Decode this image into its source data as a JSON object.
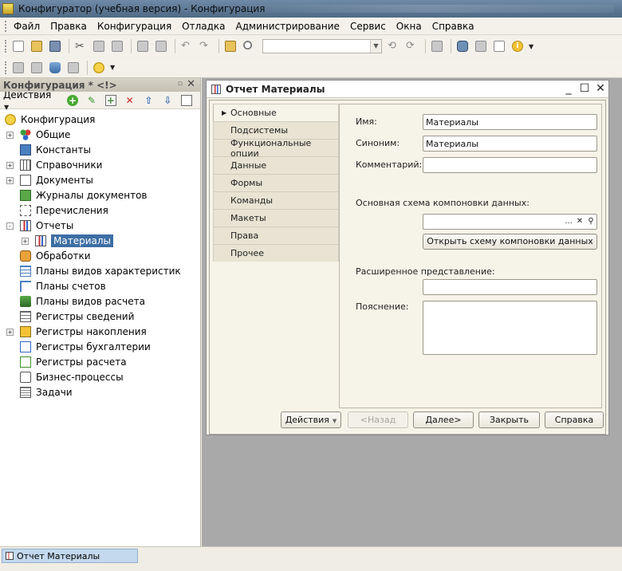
{
  "window_title": "Конфигуратор (учебная версия) - Конфигурация",
  "menu": [
    "Файл",
    "Правка",
    "Конфигурация",
    "Отладка",
    "Администрирование",
    "Сервис",
    "Окна",
    "Справка"
  ],
  "left_panel": {
    "title": "Конфигурация * <!>",
    "actions_label": "Действия",
    "tree": [
      {
        "label": "Конфигурация",
        "level": 0,
        "expander": "",
        "icon": "config-icon"
      },
      {
        "label": "Общие",
        "level": 1,
        "expander": "+",
        "icon": "common-icon"
      },
      {
        "label": "Константы",
        "level": 1,
        "expander": "",
        "icon": "constants-icon"
      },
      {
        "label": "Справочники",
        "level": 1,
        "expander": "+",
        "icon": "catalogs-icon"
      },
      {
        "label": "Документы",
        "level": 1,
        "expander": "+",
        "icon": "documents-icon"
      },
      {
        "label": "Журналы документов",
        "level": 1,
        "expander": "",
        "icon": "journals-icon"
      },
      {
        "label": "Перечисления",
        "level": 1,
        "expander": "",
        "icon": "enums-icon"
      },
      {
        "label": "Отчеты",
        "level": 1,
        "expander": "-",
        "icon": "reports-icon"
      },
      {
        "label": "Материалы",
        "level": 2,
        "expander": "+",
        "icon": "report-item-icon",
        "selected": true
      },
      {
        "label": "Обработки",
        "level": 1,
        "expander": "",
        "icon": "processing-icon"
      },
      {
        "label": "Планы видов характеристик",
        "level": 1,
        "expander": "",
        "icon": "char-plans-icon"
      },
      {
        "label": "Планы счетов",
        "level": 1,
        "expander": "",
        "icon": "accounts-plans-icon"
      },
      {
        "label": "Планы видов расчета",
        "level": 1,
        "expander": "",
        "icon": "calc-plans-icon"
      },
      {
        "label": "Регистры сведений",
        "level": 1,
        "expander": "",
        "icon": "info-registers-icon"
      },
      {
        "label": "Регистры накопления",
        "level": 1,
        "expander": "+",
        "icon": "accum-registers-icon"
      },
      {
        "label": "Регистры бухгалтерии",
        "level": 1,
        "expander": "",
        "icon": "acct-registers-icon"
      },
      {
        "label": "Регистры расчета",
        "level": 1,
        "expander": "",
        "icon": "calc-registers-icon"
      },
      {
        "label": "Бизнес-процессы",
        "level": 1,
        "expander": "",
        "icon": "bizproc-icon"
      },
      {
        "label": "Задачи",
        "level": 1,
        "expander": "",
        "icon": "tasks-icon"
      }
    ]
  },
  "report_window": {
    "title": "Отчет Материалы",
    "tabs": [
      "Основные",
      "Подсистемы",
      "Функциональные опции",
      "Данные",
      "Формы",
      "Команды",
      "Макеты",
      "Права",
      "Прочее"
    ],
    "active_tab": 0,
    "fields": {
      "name_label": "Имя:",
      "name_value": "Материалы",
      "synonym_label": "Синоним:",
      "synonym_value": "Материалы",
      "comment_label": "Комментарий:",
      "comment_value": "",
      "schema_label": "Основная схема компоновки данных:",
      "schema_value": "",
      "schema_btn_dots": "...",
      "schema_btn_clear": "✕",
      "open_schema_button": "Открыть схему компоновки данных",
      "ext_repr_label": "Расширенное представление:",
      "ext_repr_value": "",
      "explanation_label": "Пояснение:",
      "explanation_value": ""
    },
    "buttons": {
      "actions": "Действия",
      "back": "<Назад",
      "next": "Далее>",
      "close": "Закрыть",
      "help": "Справка"
    }
  },
  "taskbar": {
    "tab_label": "Отчет Материалы"
  }
}
